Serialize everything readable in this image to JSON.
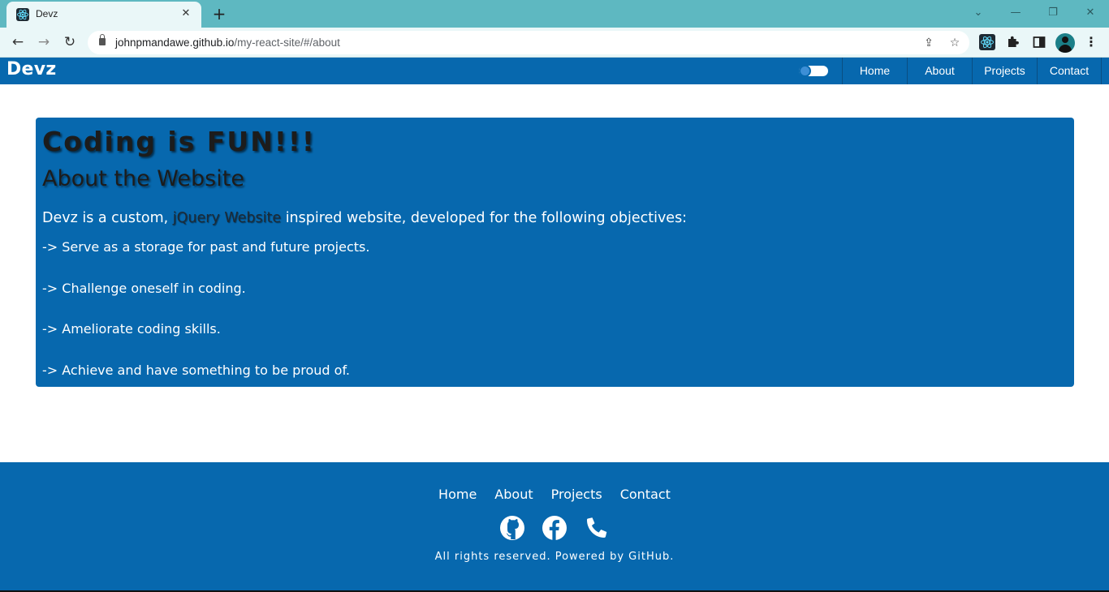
{
  "browser": {
    "tab": {
      "title": "Devz",
      "close_glyph": "✕",
      "favicon": "react-icon"
    },
    "new_tab_glyph": "+",
    "window_controls": {
      "dropdown": "⌄",
      "minimize": "—",
      "restore": "❐",
      "close": "✕"
    },
    "toolbar": {
      "back": "←",
      "forward": "→",
      "reload": "↻"
    },
    "address": {
      "host": "johnpmandawe.github.io",
      "path": "/my-react-site/#/about"
    },
    "icons": [
      "lock-icon",
      "share-icon",
      "star-icon",
      "react-extension-icon",
      "puzzle-icon",
      "side-panel-icon",
      "profile-icon",
      "kebab-menu-icon"
    ]
  },
  "site": {
    "brand": "Devz",
    "nav": {
      "home": "Home",
      "about": "About",
      "projects": "Projects",
      "contact": "Contact"
    },
    "about": {
      "heading": "Coding is FUN!!!",
      "subheading": "About the Website",
      "intro_before": "Devz is a custom, ",
      "intro_link": "jQuery Website",
      "intro_after": " inspired website, developed for the following objectives:",
      "objectives": [
        "-> Serve as a storage for past and future projects.",
        "-> Challenge oneself in coding.",
        "-> Ameliorate coding skills.",
        "-> Achieve and have something to be proud of."
      ]
    },
    "footer": {
      "links": {
        "home": "Home",
        "about": "About",
        "projects": "Projects",
        "contact": "Contact"
      },
      "socials": [
        "github-icon",
        "facebook-icon",
        "phone-icon"
      ],
      "copyright": "All rights reserved. Powered by GitHub."
    },
    "colors": {
      "primary": "#0768ae",
      "heading": "#1c1c1c",
      "tab_strip": "#5eb8c1",
      "toolbar": "#eaf7f8"
    }
  }
}
